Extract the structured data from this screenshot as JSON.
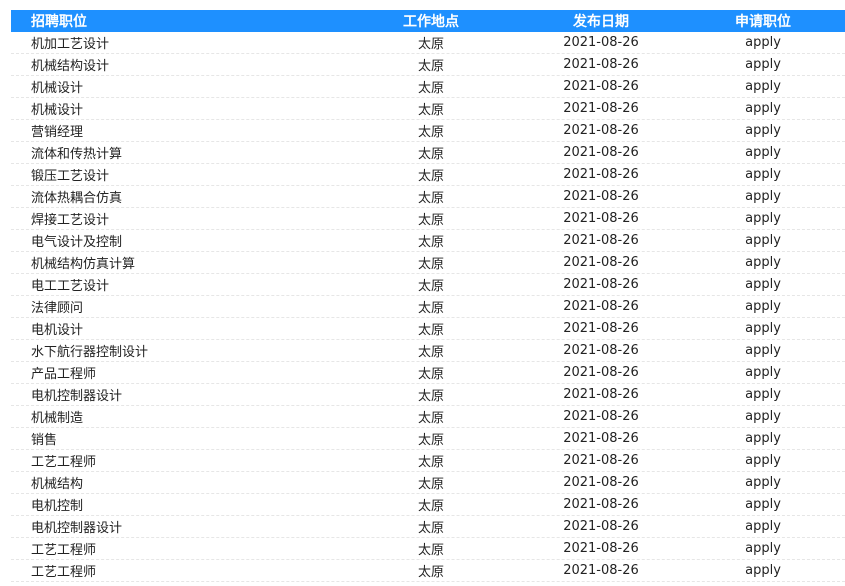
{
  "table": {
    "headers": {
      "position": "招聘职位",
      "location": "工作地点",
      "date": "发布日期",
      "apply": "申请职位"
    },
    "rows": [
      {
        "position": "机加工艺设计",
        "location": "太原",
        "date": "2021-08-26",
        "apply": "apply"
      },
      {
        "position": "机械结构设计",
        "location": "太原",
        "date": "2021-08-26",
        "apply": "apply"
      },
      {
        "position": "机械设计",
        "location": "太原",
        "date": "2021-08-26",
        "apply": "apply"
      },
      {
        "position": "机械设计",
        "location": "太原",
        "date": "2021-08-26",
        "apply": "apply"
      },
      {
        "position": "营销经理",
        "location": "太原",
        "date": "2021-08-26",
        "apply": "apply"
      },
      {
        "position": "流体和传热计算",
        "location": "太原",
        "date": "2021-08-26",
        "apply": "apply"
      },
      {
        "position": "锻压工艺设计",
        "location": "太原",
        "date": "2021-08-26",
        "apply": "apply"
      },
      {
        "position": "流体热耦合仿真",
        "location": "太原",
        "date": "2021-08-26",
        "apply": "apply"
      },
      {
        "position": "焊接工艺设计",
        "location": "太原",
        "date": "2021-08-26",
        "apply": "apply"
      },
      {
        "position": "电气设计及控制",
        "location": "太原",
        "date": "2021-08-26",
        "apply": "apply"
      },
      {
        "position": "机械结构仿真计算",
        "location": "太原",
        "date": "2021-08-26",
        "apply": "apply"
      },
      {
        "position": "电工工艺设计",
        "location": "太原",
        "date": "2021-08-26",
        "apply": "apply"
      },
      {
        "position": "法律顾问",
        "location": "太原",
        "date": "2021-08-26",
        "apply": "apply"
      },
      {
        "position": "电机设计",
        "location": "太原",
        "date": "2021-08-26",
        "apply": "apply"
      },
      {
        "position": "水下航行器控制设计",
        "location": "太原",
        "date": "2021-08-26",
        "apply": "apply"
      },
      {
        "position": "产品工程师",
        "location": "太原",
        "date": "2021-08-26",
        "apply": "apply"
      },
      {
        "position": "电机控制器设计",
        "location": "太原",
        "date": "2021-08-26",
        "apply": "apply"
      },
      {
        "position": "机械制造",
        "location": "太原",
        "date": "2021-08-26",
        "apply": "apply"
      },
      {
        "position": "销售",
        "location": "太原",
        "date": "2021-08-26",
        "apply": "apply"
      },
      {
        "position": "工艺工程师",
        "location": "太原",
        "date": "2021-08-26",
        "apply": "apply"
      },
      {
        "position": "机械结构",
        "location": "太原",
        "date": "2021-08-26",
        "apply": "apply"
      },
      {
        "position": "电机控制",
        "location": "太原",
        "date": "2021-08-26",
        "apply": "apply"
      },
      {
        "position": "电机控制器设计",
        "location": "太原",
        "date": "2021-08-26",
        "apply": "apply"
      },
      {
        "position": "工艺工程师",
        "location": "太原",
        "date": "2021-08-26",
        "apply": "apply"
      },
      {
        "position": "工艺工程师",
        "location": "太原",
        "date": "2021-08-26",
        "apply": "apply"
      }
    ]
  },
  "colors": {
    "header_bg": "#1e90ff",
    "header_text": "#ffffff",
    "row_text": "#222222"
  }
}
